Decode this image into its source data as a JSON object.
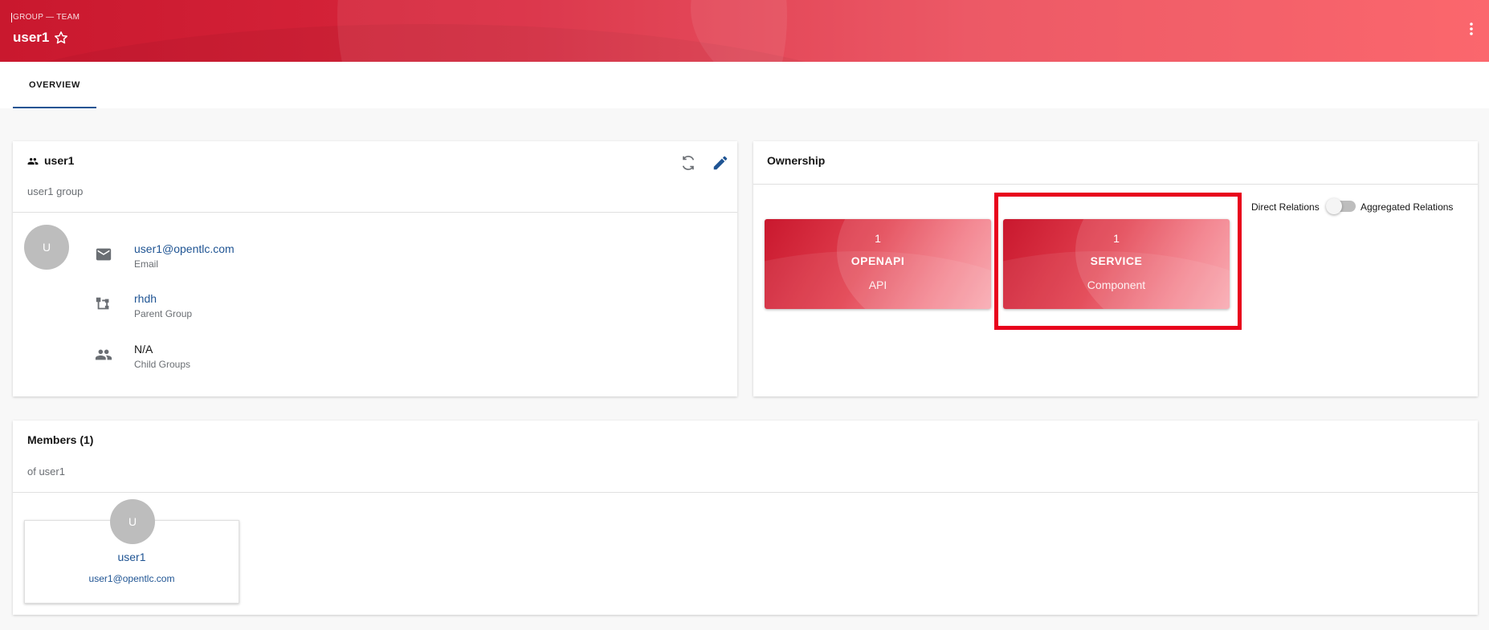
{
  "header": {
    "kind": "GROUP — TEAM",
    "title": "user1"
  },
  "tabs": [
    {
      "label": "OVERVIEW",
      "active": true
    }
  ],
  "about": {
    "title": "user1",
    "subtitle": "user1 group",
    "avatar_letter": "U",
    "fields": [
      {
        "value": "user1@opentlc.com",
        "label": "Email",
        "icon": "email-icon",
        "is_link": true
      },
      {
        "value": "rhdh",
        "label": "Parent Group",
        "icon": "hierarchy-icon",
        "is_link": true
      },
      {
        "value": "N/A",
        "label": "Child Groups",
        "icon": "group-icon",
        "is_link": false
      }
    ]
  },
  "ownership": {
    "title": "Ownership",
    "toggle": {
      "left_label": "Direct Relations",
      "right_label": "Aggregated Relations",
      "checked": false
    },
    "tiles": [
      {
        "count": "1",
        "name": "OPENAPI",
        "kind": "API"
      },
      {
        "count": "1",
        "name": "SERVICE",
        "kind": "Component"
      }
    ]
  },
  "members": {
    "title": "Members (1)",
    "subtitle": "of user1",
    "items": [
      {
        "avatar_letter": "U",
        "name": "user1",
        "email": "user1@opentlc.com"
      }
    ]
  },
  "colors": {
    "brand_red": "#c9182e",
    "link_blue": "#1f5493",
    "highlight": "#e8001c"
  }
}
